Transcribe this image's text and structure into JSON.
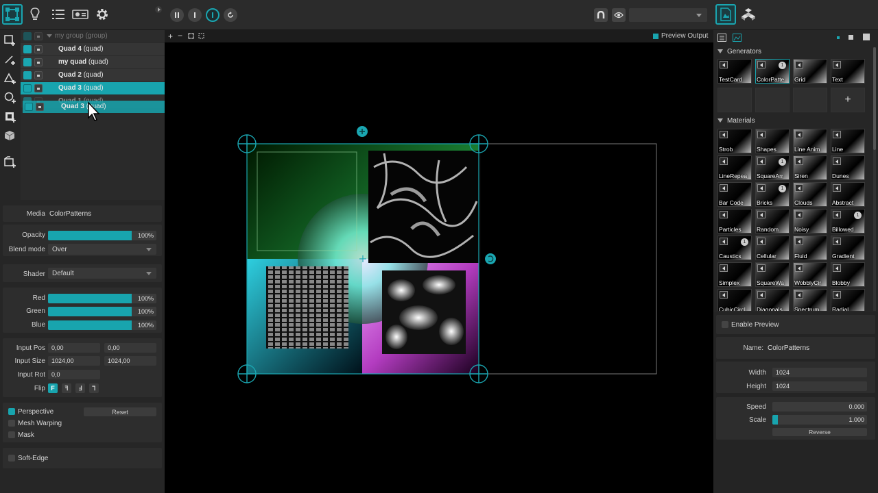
{
  "topbar": {
    "left_icons": [
      "quad-mode-icon",
      "lightbulb-icon",
      "list-icon",
      "projector-icon",
      "gear-icon"
    ],
    "transport": [
      "pause-icon",
      "stop-icon",
      "play-icon",
      "loop-icon"
    ],
    "right_icons": [
      "magnet-icon",
      "eye-icon"
    ],
    "dropdown_value": "",
    "right_tabs": [
      "media-tab-icon",
      "cubes-tab-icon"
    ]
  },
  "layers": {
    "group_label": "my group (group)",
    "items": [
      {
        "name": "Quad 4",
        "type": "(quad)"
      },
      {
        "name": "my quad",
        "type": "(quad)"
      },
      {
        "name": "Quad 2",
        "type": "(quad)"
      },
      {
        "name": "Quad 3",
        "type": "(quad)"
      },
      {
        "name": "Quad 1",
        "type": "(quad)"
      }
    ],
    "drag_name": "Quad 3",
    "drag_type": "(quad)"
  },
  "inspector": {
    "media_label": "Media",
    "media_value": "ColorPatterns",
    "opacity_label": "Opacity",
    "opacity_value": "100%",
    "opacity_fraction": 1.0,
    "blend_label": "Blend mode",
    "blend_value": "Over",
    "shader_label": "Shader",
    "shader_value": "Default",
    "red_label": "Red",
    "red_value": "100%",
    "green_label": "Green",
    "green_value": "100%",
    "blue_label": "Blue",
    "blue_value": "100%",
    "input_pos_label": "Input Pos",
    "input_pos_x": "0,00",
    "input_pos_y": "0,00",
    "input_size_label": "Input Size",
    "input_size_w": "1024,00",
    "input_size_h": "1024,00",
    "input_rot_label": "Input Rot",
    "input_rot_value": "0,0",
    "flip_label": "Flip",
    "flip_options": [
      "F",
      "ꟻ",
      "Ⅎ",
      "⅂"
    ],
    "perspective_label": "Perspective",
    "reset_label": "Reset",
    "mesh_label": "Mesh Warping",
    "mask_label": "Mask",
    "softedge_label": "Soft-Edge"
  },
  "viewport": {
    "preview_output_label": "Preview Output"
  },
  "library": {
    "generators_title": "Generators",
    "generators": [
      {
        "label": "TestCard"
      },
      {
        "label": "ColorPatte",
        "badge": "1"
      },
      {
        "label": "Grid"
      },
      {
        "label": "Text"
      }
    ],
    "add_label": "+",
    "materials_title": "Materials",
    "materials": [
      {
        "label": "Strob"
      },
      {
        "label": "Shapes"
      },
      {
        "label": "Line Anim"
      },
      {
        "label": "Line"
      },
      {
        "label": "LineRepea"
      },
      {
        "label": "SquareArr",
        "badge": "1"
      },
      {
        "label": "Siren"
      },
      {
        "label": "Dunes"
      },
      {
        "label": "Bar Code"
      },
      {
        "label": "Bricks",
        "badge": "1"
      },
      {
        "label": "Clouds"
      },
      {
        "label": "Abstract"
      },
      {
        "label": "Particles"
      },
      {
        "label": "Random"
      },
      {
        "label": "Noisy"
      },
      {
        "label": "Billowed",
        "badge": "1"
      },
      {
        "label": "Caustics",
        "badge": "1"
      },
      {
        "label": "Cellular"
      },
      {
        "label": "Fluid"
      },
      {
        "label": "Gradient"
      },
      {
        "label": "Simplex"
      },
      {
        "label": "SquareWa"
      },
      {
        "label": "WobblyCir"
      },
      {
        "label": "Blobby"
      },
      {
        "label": "CubicCircl"
      },
      {
        "label": "Diagonals"
      },
      {
        "label": "Spectrum"
      },
      {
        "label": "Radial"
      }
    ]
  },
  "media_props": {
    "enable_preview_label": "Enable Preview",
    "name_label": "Name:",
    "name_value": "ColorPatterns",
    "width_label": "Width",
    "width_value": "1024",
    "height_label": "Height",
    "height_value": "1024",
    "speed_label": "Speed",
    "speed_value": "0.000",
    "scale_label": "Scale",
    "scale_value": "1.000",
    "reverse_label": "Reverse"
  },
  "colors": {
    "accent": "#18a4ae",
    "background": "#262626",
    "viewport": "#000000"
  }
}
